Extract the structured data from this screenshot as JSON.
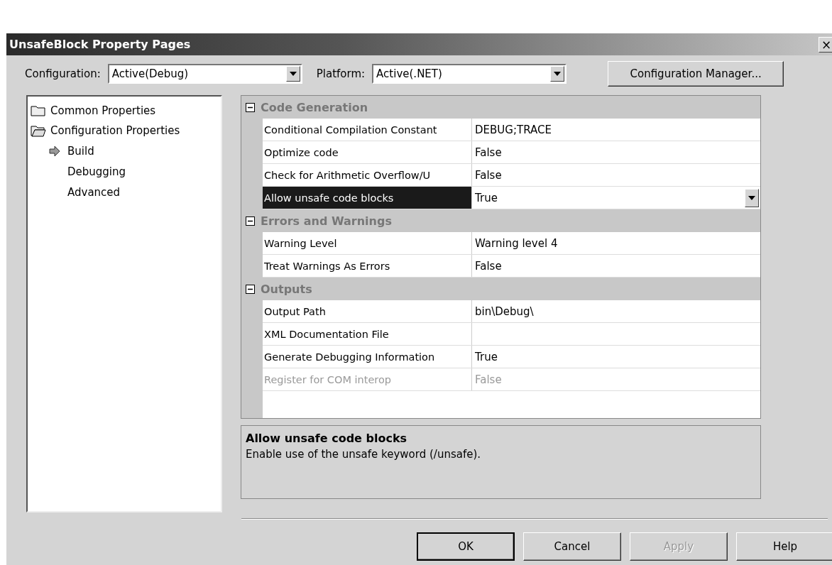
{
  "window": {
    "title": "UnsafeBlock Property Pages",
    "close": "×"
  },
  "configuration": {
    "label": "Configuration:",
    "value": "Active(Debug)"
  },
  "platform": {
    "label": "Platform:",
    "value": "Active(.NET)"
  },
  "configuration_manager_button": "Configuration Manager...",
  "tree": [
    {
      "label": "Common Properties",
      "expanded": false
    },
    {
      "label": "Configuration Properties",
      "expanded": true,
      "children": [
        {
          "label": "Build",
          "selected": true
        },
        {
          "label": "Debugging",
          "selected": false
        },
        {
          "label": "Advanced",
          "selected": false
        }
      ]
    }
  ],
  "grid": [
    {
      "kind": "category",
      "name": "Code Generation",
      "expanded": true
    },
    {
      "kind": "property",
      "name": "Conditional Compilation Constant",
      "value": "DEBUG;TRACE",
      "selected": false,
      "disabled": false
    },
    {
      "kind": "property",
      "name": "Optimize code",
      "value": "False",
      "selected": false,
      "disabled": false
    },
    {
      "kind": "property",
      "name": "Check for Arithmetic Overflow/U",
      "value": "False",
      "selected": false,
      "disabled": false
    },
    {
      "kind": "property",
      "name": "Allow unsafe code blocks",
      "value": "True",
      "selected": true,
      "disabled": false
    },
    {
      "kind": "category",
      "name": "Errors and Warnings",
      "expanded": true
    },
    {
      "kind": "property",
      "name": "Warning Level",
      "value": "Warning level 4",
      "selected": false,
      "disabled": false
    },
    {
      "kind": "property",
      "name": "Treat Warnings As Errors",
      "value": "False",
      "selected": false,
      "disabled": false
    },
    {
      "kind": "category",
      "name": "Outputs",
      "expanded": true
    },
    {
      "kind": "property",
      "name": "Output Path",
      "value": "bin\\Debug\\",
      "selected": false,
      "disabled": false
    },
    {
      "kind": "property",
      "name": "XML Documentation File",
      "selected": false,
      "disabled": false
    },
    {
      "kind": "property",
      "name": "Generate Debugging Information",
      "value": "True",
      "selected": false,
      "disabled": false
    },
    {
      "kind": "property",
      "name": "Register for COM interop",
      "value": "False",
      "selected": false,
      "disabled": true
    }
  ],
  "description": {
    "title": "Allow unsafe code blocks",
    "text": "Enable use of the unsafe keyword (/unsafe)."
  },
  "buttons": [
    {
      "label": "OK",
      "disabled": false,
      "default": true
    },
    {
      "label": "Cancel",
      "disabled": false,
      "default": false
    },
    {
      "label": "Apply",
      "disabled": true,
      "default": false
    },
    {
      "label": "Help",
      "disabled": false,
      "default": false
    }
  ]
}
